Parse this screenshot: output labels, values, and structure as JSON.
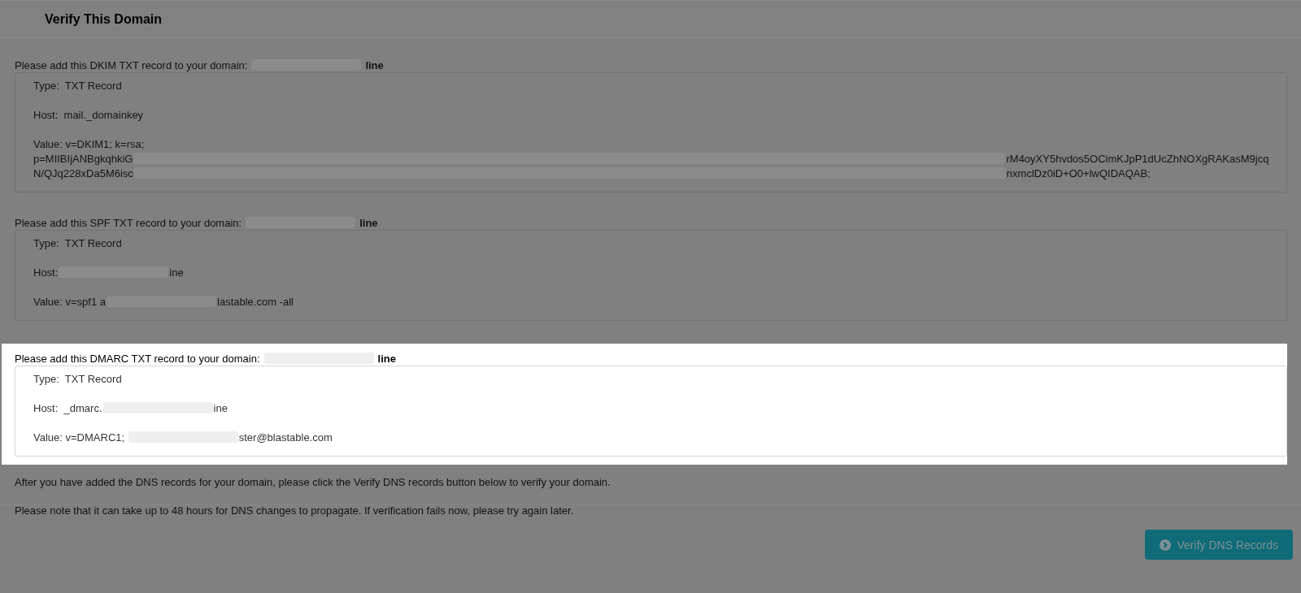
{
  "title": "Verify This Domain",
  "records": [
    {
      "highlighted": false,
      "intro": [
        {
          "kind": "text",
          "text": "Please add this DKIM TXT record to your domain:"
        },
        {
          "kind": "redacted"
        },
        {
          "kind": "bold",
          "text": "line"
        }
      ],
      "lines": [
        [
          {
            "kind": "text",
            "text": "Type:  TXT Record"
          }
        ],
        [
          {
            "kind": "text",
            "text": "Host:  mail._domainkey"
          }
        ],
        [
          {
            "kind": "text",
            "text": "Value: v=DKIM1; k=rsa;"
          }
        ],
        [
          {
            "kind": "text",
            "text": "p=MIIBIjANBgkqhkiG"
          },
          {
            "kind": "redacted_long"
          },
          {
            "kind": "text",
            "text": "rM4oyXY5hvdos5OCimKJpP1dUcZhNOXgRAKasM9jcq"
          }
        ],
        [
          {
            "kind": "text",
            "text": "N/QJq228xDa5M6isc"
          },
          {
            "kind": "redacted_long"
          },
          {
            "kind": "text",
            "text": "nxmclDz0iD+O0+lwQIDAQAB;"
          }
        ]
      ]
    },
    {
      "highlighted": false,
      "intro": [
        {
          "kind": "text",
          "text": "Please add this SPF TXT record to your domain:"
        },
        {
          "kind": "redacted"
        },
        {
          "kind": "bold",
          "text": "line"
        }
      ],
      "lines": [
        [
          {
            "kind": "text",
            "text": "Type:  TXT Record"
          }
        ],
        [
          {
            "kind": "text",
            "text": "Host:"
          },
          {
            "kind": "redacted"
          },
          {
            "kind": "text",
            "text": "ine"
          }
        ],
        [
          {
            "kind": "text",
            "text": "Value: v=spf1 a"
          },
          {
            "kind": "redacted"
          },
          {
            "kind": "text",
            "text": "lastable.com -all"
          }
        ]
      ]
    },
    {
      "highlighted": true,
      "intro": [
        {
          "kind": "text",
          "text": "Please add this DMARC TXT record to your domain:"
        },
        {
          "kind": "redacted"
        },
        {
          "kind": "bold",
          "text": "line"
        }
      ],
      "lines": [
        [
          {
            "kind": "text",
            "text": "Type:  TXT Record"
          }
        ],
        [
          {
            "kind": "text",
            "text": "Host:  _dmarc."
          },
          {
            "kind": "redacted"
          },
          {
            "kind": "text",
            "text": "ine"
          }
        ],
        [
          {
            "kind": "text",
            "text": "Value: v=DMARC1; "
          },
          {
            "kind": "redacted"
          },
          {
            "kind": "text",
            "text": "ster@blastable.com"
          }
        ]
      ]
    }
  ],
  "notes": [
    "After you have added the DNS records for your domain, please click the Verify DNS records button below to verify your domain.",
    "Please note that it can take up to 48 hours for DNS changes to propagate. If verification fails now, please try again later."
  ],
  "button": "Verify DNS Records"
}
